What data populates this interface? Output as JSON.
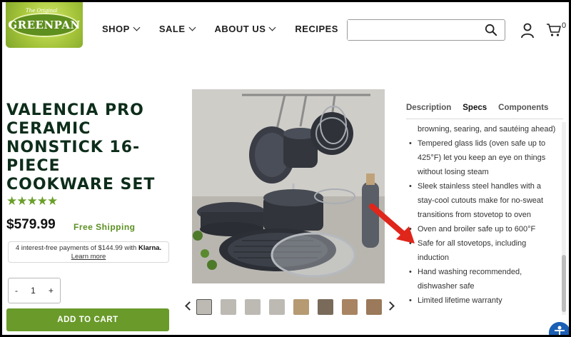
{
  "logo": {
    "brand": "GREENPAN",
    "tagline": "The Original"
  },
  "nav": {
    "items": [
      {
        "label": "SHOP",
        "dropdown": true
      },
      {
        "label": "SALE",
        "dropdown": true
      },
      {
        "label": "ABOUT US",
        "dropdown": true
      },
      {
        "label": "RECIPES",
        "dropdown": false
      }
    ]
  },
  "search": {
    "placeholder": "",
    "value": ""
  },
  "cart": {
    "count": "0"
  },
  "product": {
    "title": "VALENCIA PRO CERAMIC NONSTICK 16-PIECE COOKWARE SET",
    "rating_stars": "★★★★★",
    "rating": 4.5,
    "price": "$579.99",
    "shipping": "Free Shipping",
    "klarna_line": "4 interest-free payments of $144.99 with",
    "klarna_brand": "Klarna.",
    "klarna_link": "Learn more",
    "quantity": "1",
    "qty_minus": "-",
    "qty_plus": "+",
    "add_to_cart": "ADD TO CART"
  },
  "tabs": [
    {
      "label": "Description",
      "active": false
    },
    {
      "label": "Specs",
      "active": true
    },
    {
      "label": "Components",
      "active": false
    }
  ],
  "specs": [
    {
      "text": "browning, searing, and sautéing ahead)",
      "bullet": false
    },
    {
      "text": "Tempered glass lids (oven safe up to 425°F) let you keep an eye on things without losing steam",
      "bullet": true
    },
    {
      "text": "Sleek stainless steel handles with a stay-cool cutouts make for no-sweat transitions from stovetop to oven",
      "bullet": true
    },
    {
      "text": "Oven and broiler safe up to 600°F",
      "bullet": true
    },
    {
      "text": "Safe for all stovetops, including induction",
      "bullet": true
    },
    {
      "text": "Hand washing recommended, dishwasher safe",
      "bullet": true
    },
    {
      "text": "Limited lifetime warranty",
      "bullet": true
    }
  ],
  "colors": {
    "brand_green": "#6a9a2a",
    "title_dark_green": "#0d2d1a",
    "arrow_red": "#e0251b"
  },
  "thumbnails": {
    "count": 8,
    "active_index": 0
  }
}
